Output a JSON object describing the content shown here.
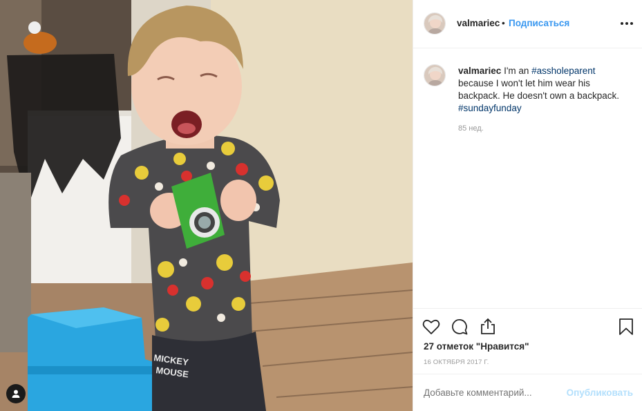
{
  "header": {
    "username": "valmariec",
    "separator": "•",
    "follow_label": "Подписаться",
    "more_icon": "more-horizontal-icon"
  },
  "caption": {
    "username": "valmariec",
    "text_before": " I'm an ",
    "hashtag_1": "#assholeparent",
    "text_middle": " because I won't let him wear his backpack. He doesn't own a backpack. ",
    "hashtag_2": "#sundayfunday",
    "time": "85 нед."
  },
  "actions": {
    "like_icon": "heart-icon",
    "comment_icon": "comment-bubble-icon",
    "share_icon": "share-icon",
    "save_icon": "bookmark-icon",
    "likes_text": "27 отметок \"Нравится\"",
    "date": "16 ОКТЯБРЯ 2017 Г."
  },
  "composer": {
    "placeholder": "Добавьте комментарий...",
    "publish_label": "Опубликовать"
  },
  "photo": {
    "tag_icon": "user-tag-icon"
  },
  "colors": {
    "link_blue": "#3897f0",
    "hashtag": "#003569",
    "publish_disabled": "#b2dffc",
    "muted": "#999999"
  }
}
